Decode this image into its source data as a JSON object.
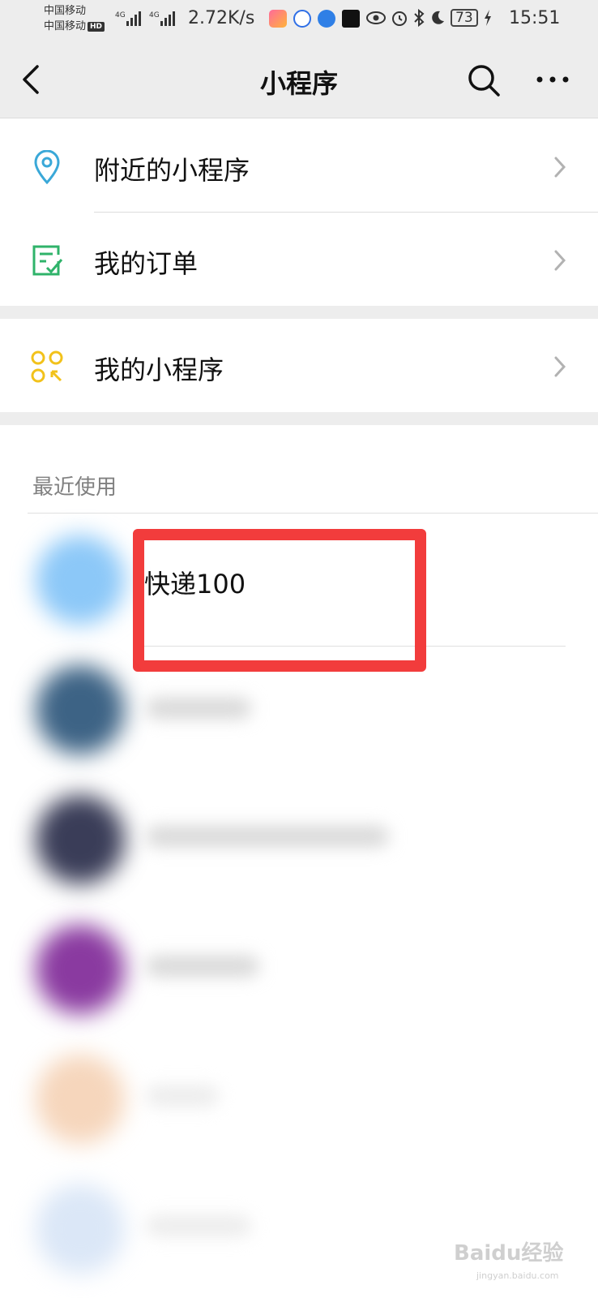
{
  "status_bar": {
    "carrier_1": "中国移动",
    "carrier_2": "中国移动",
    "hd_badge": "HD",
    "net_speed": "2.72K/s",
    "battery": "73",
    "time": "15:51"
  },
  "nav": {
    "title": "小程序"
  },
  "menu": {
    "nearby": "附近的小程序",
    "orders": "我的订单",
    "my_programs": "我的小程序"
  },
  "recent": {
    "header": "最近使用",
    "first_item": "快递100"
  },
  "watermark": {
    "text": "Baidu经验",
    "sub": "jingyan.baidu.com"
  },
  "colors": {
    "nearby_icon": "#3aa8d8",
    "orders_icon": "#2fb36a",
    "my_programs_icon": "#f2c21b",
    "highlight": "#f23c3c"
  }
}
